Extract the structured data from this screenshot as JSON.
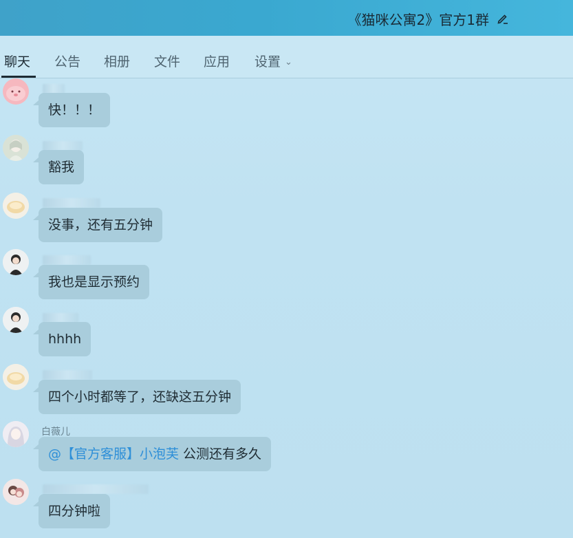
{
  "header": {
    "title": "《猫咪公寓2》官方1群",
    "edit_icon": "pencil-icon"
  },
  "tabs": [
    {
      "label": "聊天",
      "active": true
    },
    {
      "label": "公告"
    },
    {
      "label": "相册"
    },
    {
      "label": "文件"
    },
    {
      "label": "应用"
    },
    {
      "label": "设置",
      "has_dropdown": true
    }
  ],
  "messages": [
    {
      "text": "快！！！"
    },
    {
      "text": "豁我"
    },
    {
      "text": "没事，还有五分钟"
    },
    {
      "text": "我也是显示预约"
    },
    {
      "text": "hhhh"
    },
    {
      "text": "四个小时都等了，还缺这五分钟"
    },
    {
      "sender": "白薇儿",
      "mention": "@【官方客服】小泡芙",
      "text": " 公测还有多久"
    },
    {
      "text": "四分钟啦"
    }
  ],
  "colors": {
    "header": "#3fa2c9",
    "bubble": "#a9cddc",
    "mention": "#2e8fd8",
    "background": "#c4e3f1"
  }
}
